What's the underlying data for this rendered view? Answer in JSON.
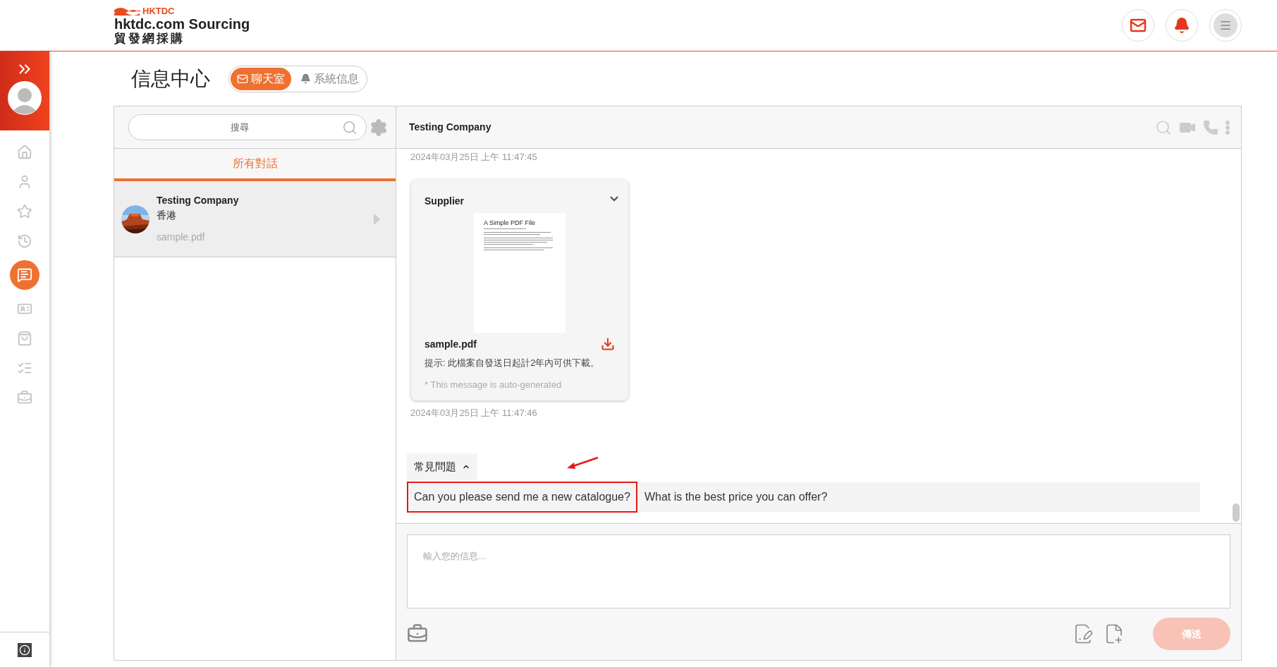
{
  "header": {
    "logo_mark": "HKTDC",
    "logo_title": "hktdc.com Sourcing",
    "logo_subtitle": "貿發網採購"
  },
  "sidebar": {
    "items": [
      {
        "selected": false
      },
      {
        "selected": false
      },
      {
        "selected": false
      },
      {
        "selected": false
      },
      {
        "selected": true
      },
      {
        "selected": false
      },
      {
        "selected": false
      },
      {
        "selected": false
      },
      {
        "selected": false
      }
    ]
  },
  "page_title": "信息中心",
  "tabs": [
    {
      "label": "聊天室",
      "selected": true
    },
    {
      "label": "系統信息",
      "selected": false
    }
  ],
  "conversation_list": {
    "search": {
      "placeholder": "搜尋"
    },
    "filter_tab": {
      "label": "所有對話",
      "selected": true
    },
    "conversations": [
      {
        "name": "Testing Company",
        "location": "香港",
        "last_message": "sample.pdf",
        "selected": true
      }
    ]
  },
  "chat": {
    "title": "Testing Company",
    "messages": [
      {
        "timestamp": "2024年03月25日 上午 11:47:45"
      },
      {
        "sender": "Supplier",
        "thumbnail_title": "A Simple PDF File",
        "file_name": "sample.pdf",
        "note": "提示: 此檔案自發送日起計2年內可供下載。",
        "footer": "* This message is auto-generated",
        "timestamp": "2024年03月25日 上午 11:47:46"
      }
    ],
    "faq": {
      "label": "常見問題",
      "expanded": true,
      "questions": [
        {
          "text": "Can you please send me a new catalogue?",
          "highlighted": true
        },
        {
          "text": "What is the best price you can offer?",
          "highlighted": false
        }
      ]
    },
    "input": {
      "placeholder": "輸入您的信息..."
    },
    "send_button": {
      "label": "傳送",
      "disabled": true
    }
  }
}
